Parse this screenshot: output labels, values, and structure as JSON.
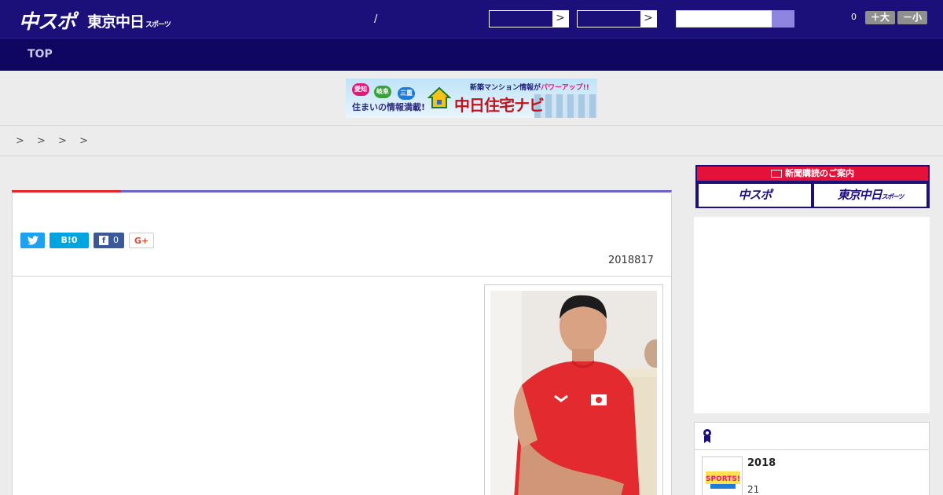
{
  "header": {
    "logo_main": "中スポ",
    "logo_second": "東京中日",
    "logo_second_small": "スポーツ",
    "slash": "/",
    "select_arrow": ">",
    "comment_count": "0",
    "font_larger": "＋大",
    "font_smaller": "－小"
  },
  "nav": {
    "top_label": "TOP"
  },
  "banner": {
    "badge_1": "愛知",
    "badge_2": "岐阜",
    "badge_3": "三重",
    "tagline": "住まいの情報満載!",
    "headline_a": "新築マンション情報が",
    "headline_b": "パワーアップ!!",
    "brand": "中日住宅ナビ"
  },
  "breadcrumb": {
    "text": "> > > >"
  },
  "article": {
    "share_twitter_icon": "twitter-icon",
    "share_hatena": "B!0",
    "share_facebook_count": "0",
    "share_gplus": "G+",
    "date": "2018817"
  },
  "sidebar": {
    "subscription_header": "新聞購読のご案内",
    "subscription_btn_1": "中スポ",
    "subscription_btn_2": "東京中日",
    "subscription_btn_2_small": "スポーツ",
    "ranking_icon": "ribbon-icon",
    "ranking_item_title": "2018",
    "ranking_item_sub": "21"
  },
  "colors": {
    "header_bg": "#1b0f7a",
    "nav_bg": "#0f0662",
    "accent_red": "#e4262a",
    "accent_purple": "#6d63c7",
    "subscription_red": "#e4123a"
  }
}
